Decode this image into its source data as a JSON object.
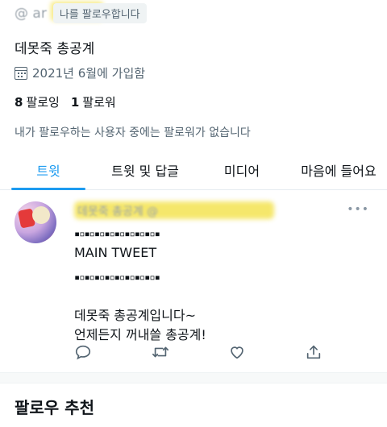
{
  "profile": {
    "handle_obscured": "@ ar",
    "follows_you": "나를 팔로우합니다",
    "name": "데못죽 총공계",
    "joined": "2021년 6월에 가입함",
    "following_count": "8",
    "following_label": "팔로잉",
    "followers_count": "1",
    "followers_label": "팔로워",
    "mutuals_note": "내가 팔로우하는 사용자 중에는 팔로워가 없습니다"
  },
  "tabs": [
    {
      "label": "트윗",
      "active": true
    },
    {
      "label": "트윗 및 답글",
      "active": false
    },
    {
      "label": "미디어",
      "active": false
    },
    {
      "label": "마음에 들어요",
      "active": false
    }
  ],
  "tweet": {
    "author_obscured": "데못죽 총공계 @",
    "more": "•••",
    "line1": "▪▫▪▫▪▫▪▫▪▫▪▫▪▫▪▫▪",
    "line2": "MAIN TWEET",
    "line3": "▪▫▪▫▪▫▪▫▪▫▪▫▪▫▪▫▪",
    "line4": "데못죽 총공계입니다~",
    "line5": "언제든지 꺼내쓸 총공계!"
  },
  "section": {
    "follow_suggestions": "팔로우 추천"
  },
  "colors": {
    "accent": "#1d9bf0",
    "secondary_text": "#536471",
    "highlight": "#f2df3a"
  }
}
